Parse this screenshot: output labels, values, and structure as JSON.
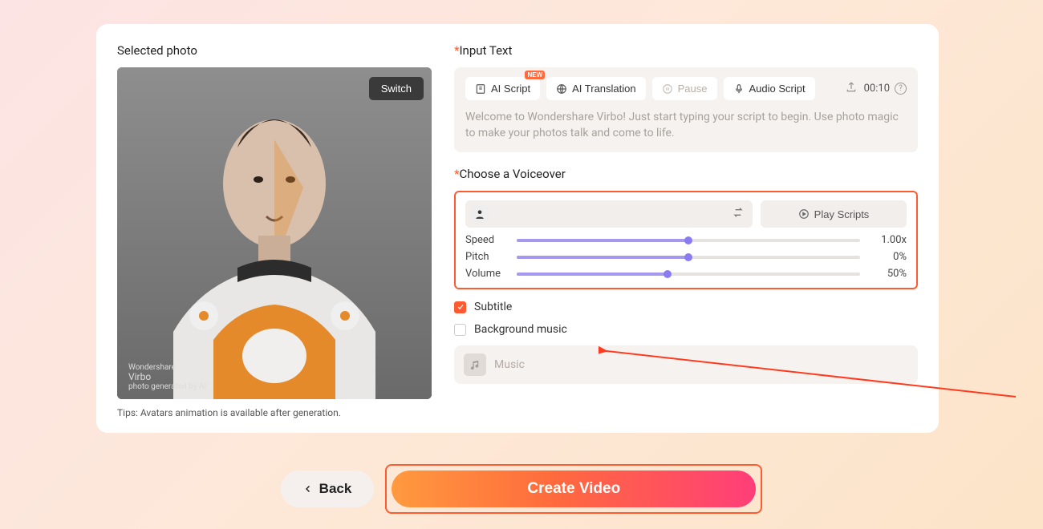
{
  "left": {
    "selected_photo_label": "Selected photo",
    "switch_label": "Switch",
    "watermark_brand": "Virbo",
    "watermark_company": "Wondershare",
    "watermark_sub": "photo generated by AI",
    "tips": "Tips: Avatars animation is available after generation."
  },
  "input": {
    "section_label": "Input Text",
    "ai_script": "AI Script",
    "new_badge": "NEW",
    "ai_translation": "AI Translation",
    "pause": "Pause",
    "audio_script": "Audio Script",
    "timecode": "00:10",
    "placeholder": "Welcome to Wondershare Virbo! Just start typing your script to begin. Use photo magic to make your photos talk and come to life."
  },
  "voiceover": {
    "section_label": "Choose a Voiceover",
    "play_scripts": "Play Scripts",
    "speed": {
      "label": "Speed",
      "value_text": "1.00x",
      "percent": 50
    },
    "pitch": {
      "label": "Pitch",
      "value_text": "0%",
      "percent": 50
    },
    "volume": {
      "label": "Volume",
      "value_text": "50%",
      "percent": 44
    }
  },
  "options": {
    "subtitle_label": "Subtitle",
    "subtitle_on": true,
    "bgm_label": "Background music",
    "bgm_on": false,
    "music_placeholder": "Music"
  },
  "footer": {
    "back": "Back",
    "create": "Create Video"
  }
}
